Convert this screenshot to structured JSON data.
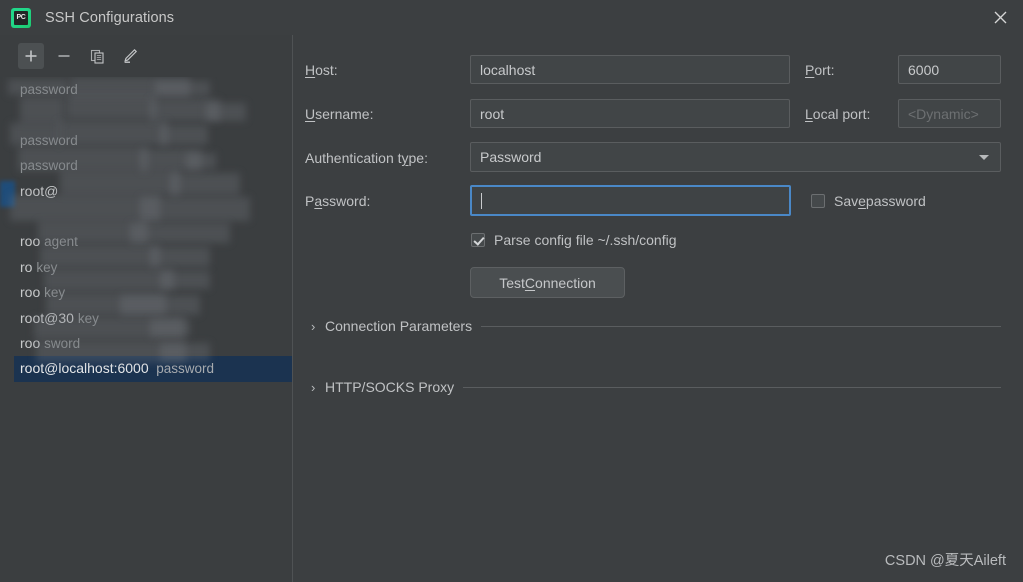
{
  "window": {
    "title": "SSH Configurations",
    "app_icon": "pycharm-icon",
    "close_label": "✕"
  },
  "toolbar": {
    "add_label": "+",
    "remove_label": "−",
    "copy_label": "copy",
    "edit_label": "edit"
  },
  "list": {
    "items": [
      {
        "name": "",
        "auth": "password",
        "redacted": true
      },
      {
        "name": "",
        "auth": "",
        "redacted": true
      },
      {
        "name": "",
        "auth": "password",
        "redacted": true
      },
      {
        "name": "",
        "auth": "password",
        "redacted": true
      },
      {
        "name": "root@",
        "auth": "",
        "redacted": true
      },
      {
        "name": "",
        "auth": "",
        "redacted": true
      },
      {
        "name": "roo",
        "auth": "agent",
        "redacted": true
      },
      {
        "name": "ro",
        "auth": "key",
        "redacted": true
      },
      {
        "name": "roo",
        "auth": "key",
        "redacted": true
      },
      {
        "name": "root@30",
        "auth": "key",
        "redacted": true
      },
      {
        "name": "roo",
        "auth": "sword",
        "redacted": true
      },
      {
        "name": "root@localhost:6000",
        "auth": "password",
        "redacted": false,
        "selected": true
      }
    ]
  },
  "form": {
    "host": {
      "label": "Host:",
      "mnemonic": "H",
      "value": "localhost"
    },
    "port": {
      "label": "Port:",
      "mnemonic": "P",
      "value": "6000"
    },
    "username": {
      "label": "Username:",
      "mnemonic": "U",
      "value": "root"
    },
    "local_port": {
      "label": "Local port:",
      "mnemonic": "L",
      "placeholder": "<Dynamic>",
      "value": ""
    },
    "auth_type": {
      "label": "Authentication type:",
      "mnemonic": "y",
      "value": "Password"
    },
    "password": {
      "label": "Password:",
      "mnemonic": "a",
      "value": "",
      "focused": true
    },
    "save_password": {
      "label": "Save password",
      "mnemonic": "e",
      "checked": false
    },
    "parse_config": {
      "label": "Parse config file ~/.ssh/config",
      "checked": true
    },
    "test_connection": {
      "label": "Test Connection",
      "mnemonic": "C"
    },
    "sections": [
      {
        "label": "Connection Parameters",
        "chevron": "›",
        "expanded": false
      },
      {
        "label": "HTTP/SOCKS Proxy",
        "chevron": "›",
        "expanded": false
      }
    ]
  },
  "watermark": {
    "text": "CSDN @夏天Aileft"
  },
  "colors": {
    "window_bg": "#3c3f41",
    "panel_bg": "#3b3e40",
    "selection_bg": "#1b3350",
    "focus_border": "#4a88c7",
    "text": "#c0c2c4",
    "muted_text": "#8d9193"
  }
}
